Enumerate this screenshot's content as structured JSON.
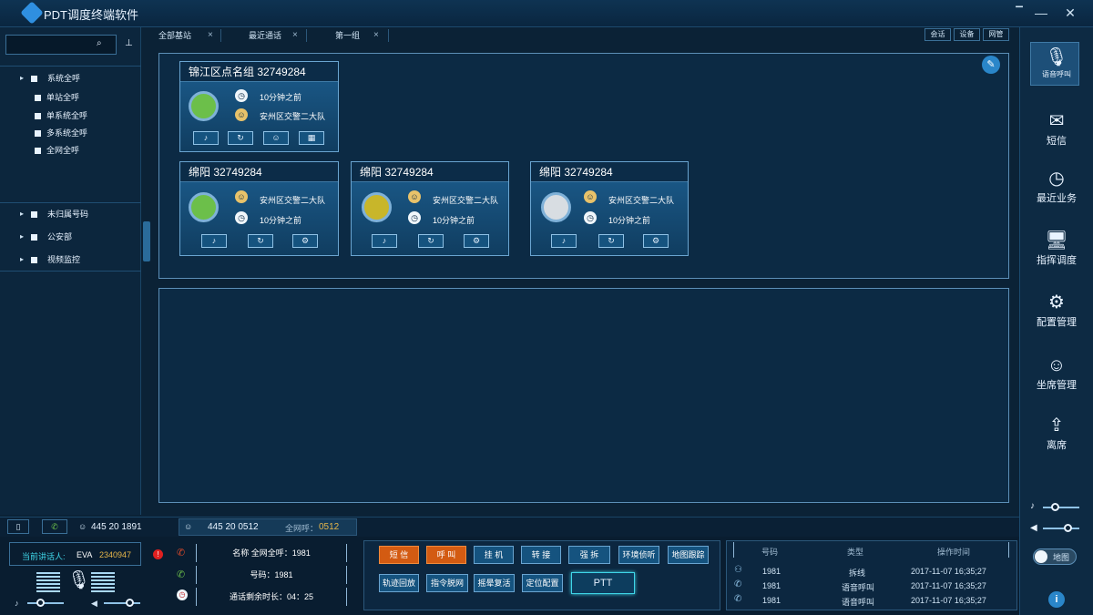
{
  "app": {
    "title": "PDT调度终端软件"
  },
  "tree": {
    "root": "系统全呼",
    "children": [
      "单站全呼",
      "单系统全呼",
      "多系统全呼",
      "全网全呼"
    ],
    "groups": [
      "未归属号码",
      "公安部",
      "视频监控"
    ]
  },
  "tabs": [
    {
      "label": "全部基站"
    },
    {
      "label": "最近通话"
    },
    {
      "label": "第一组"
    }
  ],
  "view_buttons": [
    "会话",
    "设备",
    "网管"
  ],
  "cards": [
    {
      "title": "锦江区点名组   32749284",
      "line1": "10分钟之前",
      "line2": "安州区交警二大队",
      "light": "#6cbf4a"
    },
    {
      "title": "绵阳   32749284",
      "line1": "安州区交警二大队",
      "line2": "10分钟之前",
      "light": "#6cbf4a"
    },
    {
      "title": "绵阳   32749284",
      "line1": "安州区交警二大队",
      "line2": "10分钟之前",
      "light": "#c8b62a"
    },
    {
      "title": "绵阳   32749284",
      "line1": "安州区交警二大队",
      "line2": "10分钟之前",
      "light": "#d8dde2"
    }
  ],
  "right_nav": [
    {
      "label": "语音呼叫"
    },
    {
      "label": "短信"
    },
    {
      "label": "最近业务"
    },
    {
      "label": "指挥调度"
    },
    {
      "label": "配置管理"
    },
    {
      "label": "坐席管理"
    },
    {
      "label": "离席"
    }
  ],
  "map_toggle": "地图",
  "status": {
    "num1": "445  20  1891",
    "num2": "445  20  0512",
    "allnet_label": "全网呼：",
    "allnet_value": "0512"
  },
  "speaker": {
    "label": "当前讲话人:",
    "name": "EVA",
    "id": "2340947"
  },
  "call_info": {
    "name": "名称 全网全呼：1981",
    "number": "号码：1981",
    "remaining": "通话剩余时长：04：25"
  },
  "actions": {
    "row1": [
      "短 信",
      "呼 叫",
      "挂 机",
      "转 接",
      "强 拆",
      "环境侦听",
      "地图跟踪"
    ],
    "row2": [
      "轨迹回放",
      "指令脱网",
      "摇晕复活",
      "定位配置"
    ],
    "ptt": "PTT"
  },
  "log": {
    "headers": [
      "号码",
      "类型",
      "操作时间"
    ],
    "rows": [
      [
        "1981",
        "拆线",
        "2017-11-07 16;35;27"
      ],
      [
        "1981",
        "语音呼叫",
        "2017-11-07 16;35;27"
      ],
      [
        "1981",
        "语音呼叫",
        "2017-11-07 16;35;27"
      ]
    ]
  },
  "colors": {
    "accent": "#2f8fe0",
    "orange": "#d35b12",
    "speaker_id": "#e7b64a"
  }
}
